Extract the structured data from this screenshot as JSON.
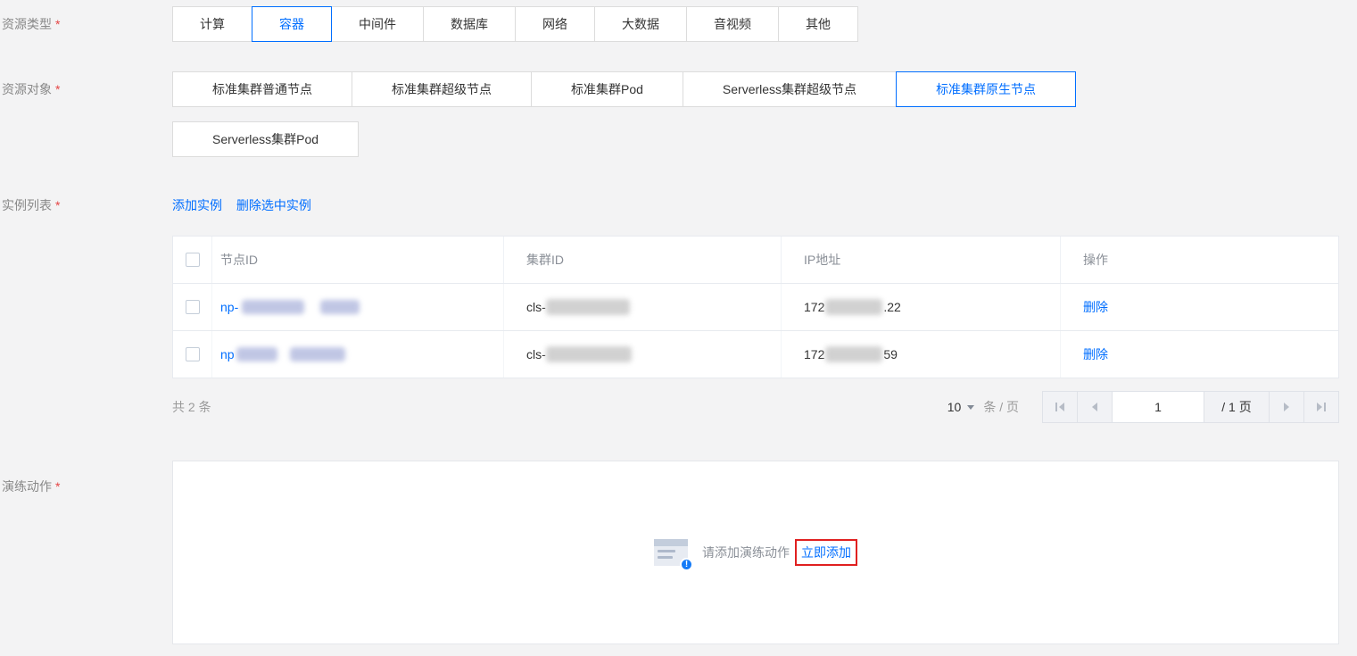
{
  "colors": {
    "accent_blue": "#006eff",
    "required_red": "#e54545",
    "annotation_red": "#e02020"
  },
  "resource_type": {
    "label": "资源类型",
    "required_mark": "*",
    "options": [
      {
        "label": "计算",
        "selected": false
      },
      {
        "label": "容器",
        "selected": true
      },
      {
        "label": "中间件",
        "selected": false
      },
      {
        "label": "数据库",
        "selected": false
      },
      {
        "label": "网络",
        "selected": false
      },
      {
        "label": "大数据",
        "selected": false
      },
      {
        "label": "音视频",
        "selected": false
      },
      {
        "label": "其他",
        "selected": false
      }
    ]
  },
  "resource_object": {
    "label": "资源对象",
    "required_mark": "*",
    "options_row1": [
      {
        "label": "标准集群普通节点",
        "selected": false
      },
      {
        "label": "标准集群超级节点",
        "selected": false
      },
      {
        "label": "标准集群Pod",
        "selected": false
      },
      {
        "label": "Serverless集群超级节点",
        "selected": false
      },
      {
        "label": "标准集群原生节点",
        "selected": true
      }
    ],
    "options_row2": [
      {
        "label": "Serverless集群Pod",
        "selected": false
      }
    ]
  },
  "instance_list": {
    "label": "实例列表",
    "required_mark": "*",
    "add_link": "添加实例",
    "delete_link": "删除选中实例",
    "table": {
      "columns": [
        "节点ID",
        "集群ID",
        "IP地址",
        "操作"
      ],
      "rows": [
        {
          "node_id_visible": "np-",
          "cluster_id_visible": "cls-",
          "ip_visible_prefix": "172",
          "ip_visible_suffix": ".22",
          "action": "删除"
        },
        {
          "node_id_visible": "np",
          "cluster_id_visible": "cls-",
          "ip_visible_prefix": "172",
          "ip_visible_suffix": "59",
          "action": "删除"
        }
      ]
    },
    "pagination": {
      "total_text": "共 2 条",
      "page_size": "10",
      "unit_label": "条 / 页",
      "current_page": "1",
      "page_total_label": "/ 1 页"
    }
  },
  "drill_action": {
    "label": "演练动作",
    "required_mark": "*",
    "empty_hint": "请添加演练动作",
    "add_now_link": "立即添加"
  }
}
